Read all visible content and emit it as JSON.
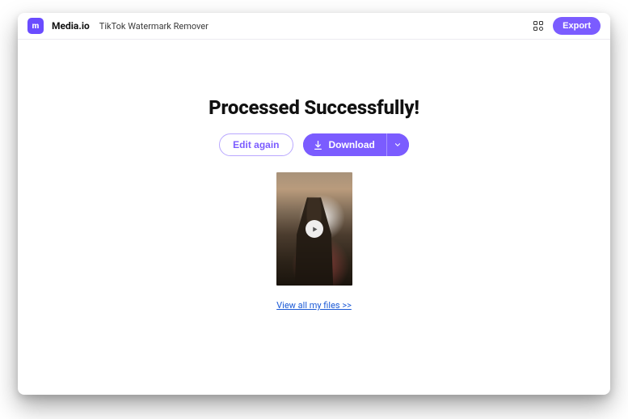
{
  "header": {
    "brand": "Media.io",
    "page_name": "TikTok Watermark Remover",
    "logo_letter": "m",
    "export_label": "Export",
    "icons": {
      "logo": "logo-icon",
      "apps": "apps-grid-icon"
    }
  },
  "main": {
    "title": "Processed Successfully!",
    "edit_label": "Edit again",
    "download_label": "Download",
    "view_files_link": "View all my files >>",
    "icons": {
      "download": "download-icon",
      "dropdown": "chevron-down-icon",
      "play": "play-icon"
    }
  },
  "colors": {
    "accent": "#7b5cff",
    "link": "#1a59d6"
  }
}
